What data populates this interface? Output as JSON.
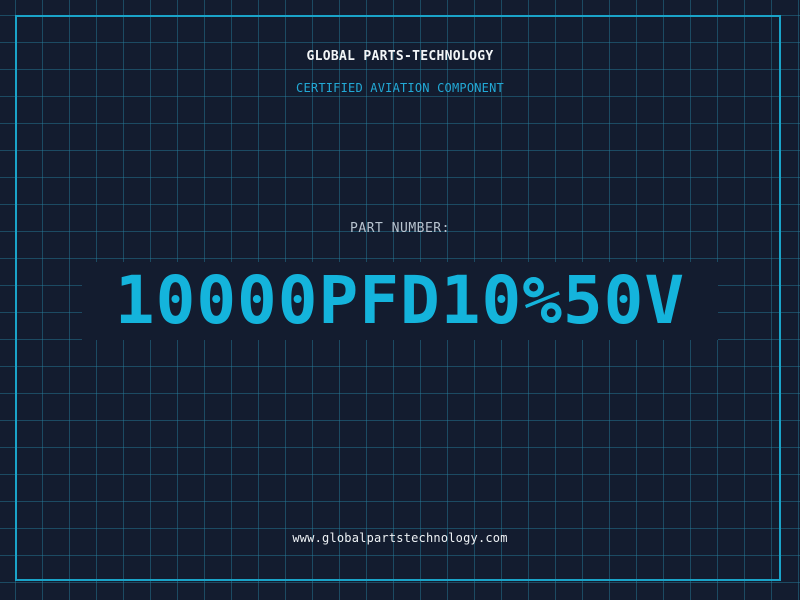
{
  "header": {
    "brand": "GLOBAL PARTS-TECHNOLOGY",
    "tagline": "CERTIFIED AVIATION COMPONENT"
  },
  "main": {
    "part_label": "PART NUMBER:",
    "part_number": "10000PFD10%50V"
  },
  "footer": {
    "website": "www.globalpartstechnology.com"
  },
  "colors": {
    "background": "#131c2f",
    "grid": "#28829f",
    "accent": "#14b4dc",
    "frame": "#1aa3c8"
  }
}
